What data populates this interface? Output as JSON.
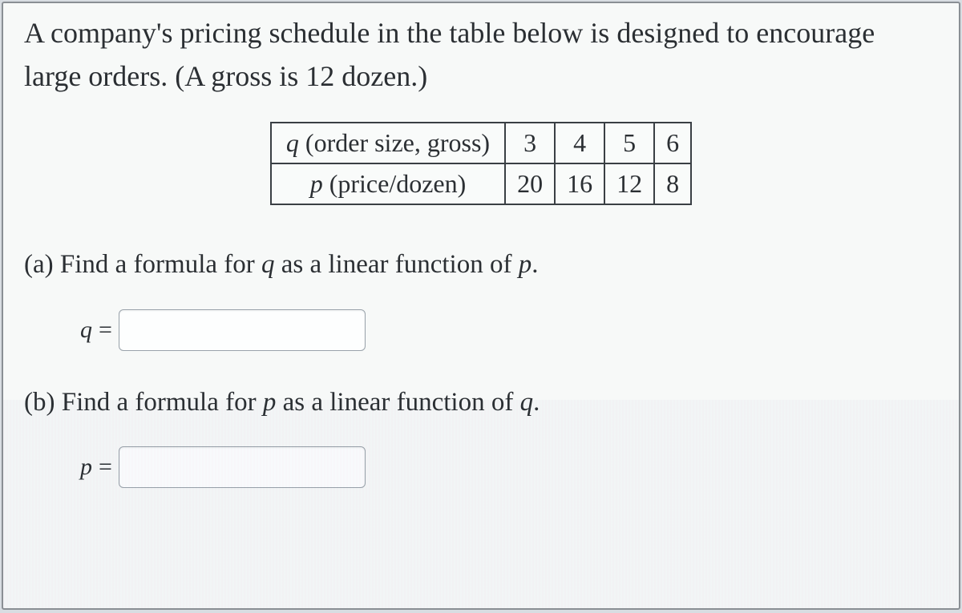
{
  "intro": "A company's pricing schedule in the table below is designed to encourage large orders. (A gross is 12 dozen.)",
  "table": {
    "row_q_label_html": "<span class=\"ivar\">q</span> (order size, gross)",
    "row_p_label_html": "<span class=\"ivar\">p</span> (price/dozen)",
    "q_values": [
      "3",
      "4",
      "5",
      "6"
    ],
    "p_values": [
      "20",
      "16",
      "12",
      "8"
    ]
  },
  "part_a": {
    "prompt_html": "(a) Find a formula for <span class=\"ivar\">q</span> as a linear function of <span class=\"ivar\">p</span>.",
    "var_label": "q",
    "eq": "=",
    "input_value": ""
  },
  "part_b": {
    "prompt_html": "(b) Find a formula for <span class=\"ivar\">p</span> as a linear function of <span class=\"ivar\">q</span>.",
    "var_label": "p",
    "eq": "=",
    "input_value": ""
  },
  "chart_data": {
    "type": "table",
    "title": "Pricing schedule",
    "columns": [
      "q (order size, gross)",
      "p (price/dozen)"
    ],
    "rows": [
      {
        "q": 3,
        "p": 20
      },
      {
        "q": 4,
        "p": 16
      },
      {
        "q": 5,
        "p": 12
      },
      {
        "q": 6,
        "p": 8
      }
    ]
  }
}
